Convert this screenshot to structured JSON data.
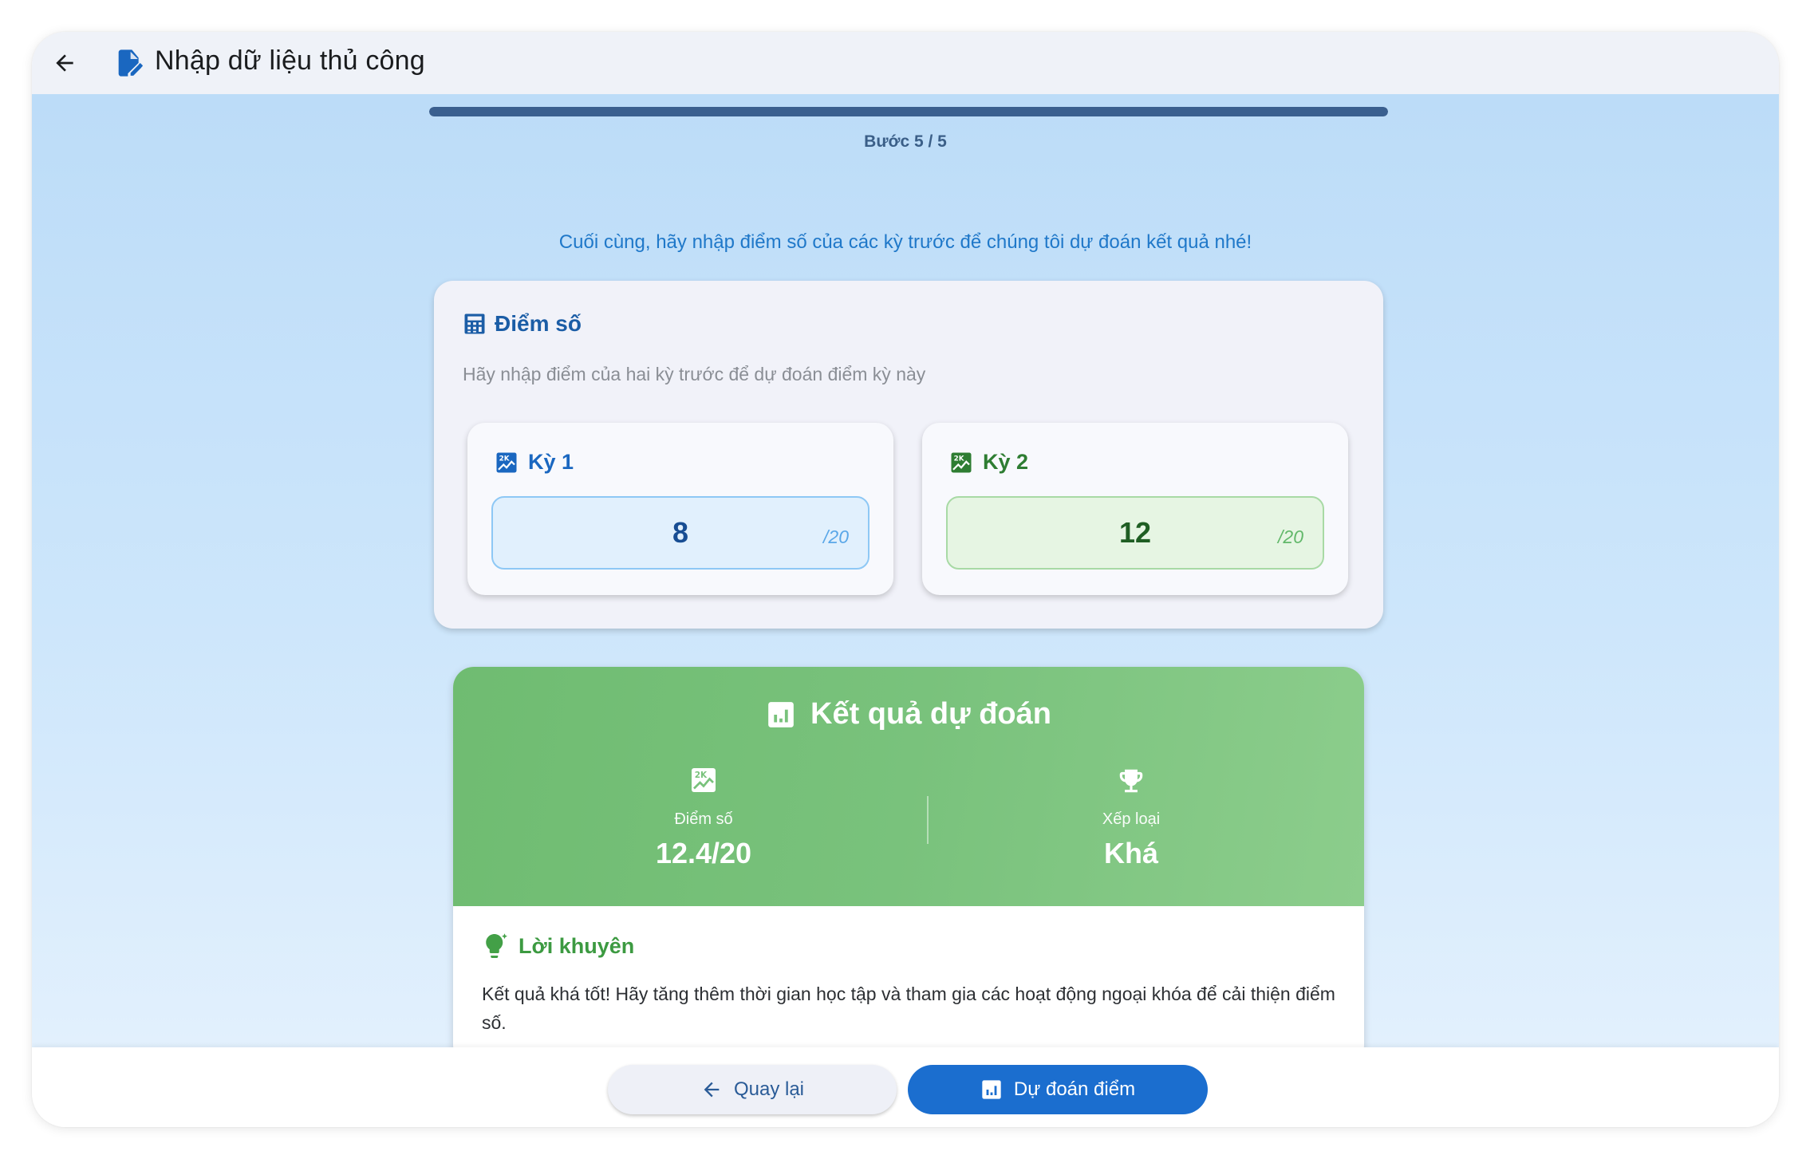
{
  "appbar": {
    "title": "Nhập dữ liệu thủ công",
    "back_icon": "arrow-back-icon",
    "title_icon": "edit-document-icon"
  },
  "progress": {
    "step_label": "Bước 5 / 5",
    "current": 5,
    "total": 5,
    "fraction": 1.0
  },
  "intro_text": "Cuối cùng, hãy nhập điểm số của các kỳ trước để chúng tôi dự đoán kết quả nhé!",
  "score_card": {
    "title": "Điểm số",
    "icon": "calculator-icon",
    "subtitle": "Hãy nhập điểm của hai kỳ trước để dự đoán điểm kỳ này",
    "terms": [
      {
        "label": "Kỳ 1",
        "value": "8",
        "suffix": "/20",
        "icon": "grade-icon",
        "color": "#1a67c0"
      },
      {
        "label": "Kỳ 2",
        "value": "12",
        "suffix": "/20",
        "icon": "grade-icon",
        "color": "#2e7d32"
      }
    ]
  },
  "result": {
    "title": "Kết quả dự đoán",
    "icon": "bar-chart-icon",
    "score": {
      "caption": "Điểm số",
      "value": "12.4/20",
      "icon": "grade-icon"
    },
    "rank": {
      "caption": "Xếp loại",
      "value": "Khá",
      "icon": "trophy-icon"
    },
    "advice": {
      "title": "Lời khuyên",
      "icon": "lightbulb-icon",
      "text": "Kết quả khá tốt! Hãy tăng thêm thời gian học tập và tham gia các hoạt động ngoại khóa để cải thiện điểm số."
    }
  },
  "actions": {
    "back_label": "Quay lại",
    "predict_label": "Dự đoán điểm"
  },
  "colors": {
    "primary": "#1b6ecf",
    "success": "#79c27c",
    "background": "#bcdcf8"
  }
}
